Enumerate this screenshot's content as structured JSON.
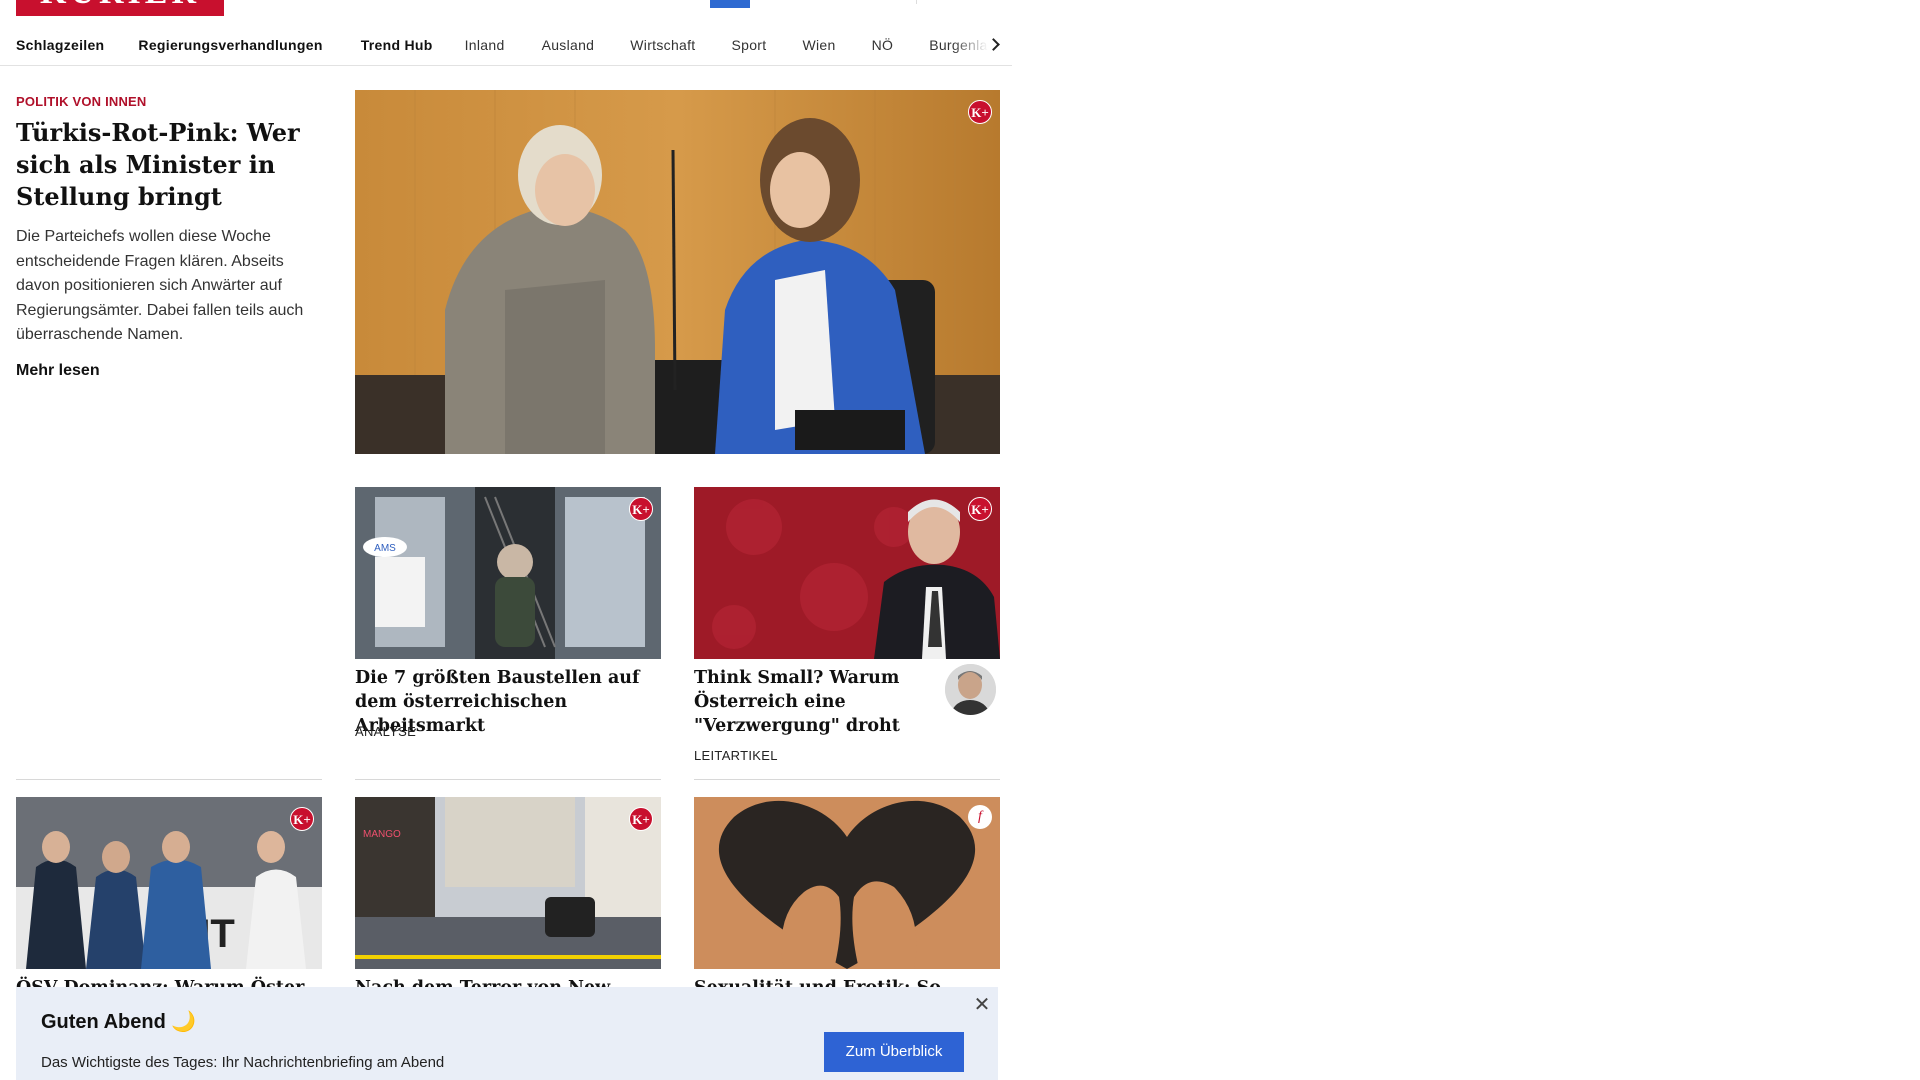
{
  "header": {
    "logo_text": "KURIER"
  },
  "nav": {
    "items": [
      {
        "label": "Schlagzeilen",
        "bold": true
      },
      {
        "label": "Regierungsverhandlungen",
        "bold": true
      },
      {
        "label": "Trend Hub",
        "bold": true
      },
      {
        "label": "Inland"
      },
      {
        "label": "Ausland"
      },
      {
        "label": "Wirtschaft"
      },
      {
        "label": "Sport"
      },
      {
        "label": "Wien"
      },
      {
        "label": "NÖ"
      },
      {
        "label": "Burgenland"
      }
    ]
  },
  "lead": {
    "kicker": "POLITIK VON INNEN",
    "title": "Türkis-Rot-Pink: Wer sich als Minister in Stel­lung bringt",
    "teaser": "Die Parteichefs wollen diese Woche entscheidende Fragen klären. Abseits davon positionieren sich Anwärter auf Regierungsämter. Dabei fallen teils auch überraschende Namen.",
    "more": "Mehr lesen",
    "badge": "K+"
  },
  "cards": [
    {
      "title": "Die 7 größten Baustellen auf dem österreichischen Arbeitsmarkt",
      "label": "ANALYSE",
      "badge": "K+"
    },
    {
      "title": "Think Small? Warum Ös­terreich eine \"Verzwer­gung\" droht",
      "label": "LEITARTIKEL",
      "badge": "K+"
    },
    {
      "title": "ÖSV-Dominanz: Warum Öster",
      "badge": "K+"
    },
    {
      "title": "Nach dem Terror von New Orleans:",
      "badge": "K+"
    },
    {
      "title": "Sexualität und Erotik: So schaut's",
      "badge": "f"
    }
  ],
  "banner": {
    "title": "Guten Abend 🌙",
    "subtitle": "Das Wichtigste des Tages: Ihr Nachrichtenbriefing am Abend",
    "button": "Zum Überblick",
    "close": "✕"
  },
  "colors": {
    "brand": "#c8102e",
    "accent": "#2e63d4",
    "banner_bg": "#e9eef7"
  }
}
